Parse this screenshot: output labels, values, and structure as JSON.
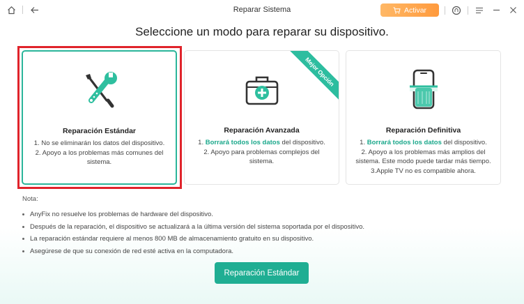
{
  "window": {
    "title": "Reparar Sistema",
    "activate_label": "Activar"
  },
  "heading": "Seleccione un modo para reparar su dispositivo.",
  "cards": [
    {
      "title": "Reparación Estándar",
      "line1": "1. No se eliminarán los datos del dispositivo.",
      "line2": "2. Apoyo a los problemas más comunes del sistema."
    },
    {
      "title": "Reparación Avanzada",
      "badge": "Mejor Opción",
      "line1_pre": "1. ",
      "line1_hl": "Borrará todos los datos",
      "line1_post": " del dispositivo.",
      "line2": "2. Apoyo para problemas complejos del sistema."
    },
    {
      "title": "Reparación Definitiva",
      "line1_pre": "1. ",
      "line1_hl": "Borrará todos los datos",
      "line1_post": " del dispositivo.",
      "line2": "2. Apoyo a los problemas más amplios del sistema. Este modo puede tardar más tiempo.",
      "line3": "3.Apple TV no es compatible ahora."
    }
  ],
  "note": {
    "title": "Nota:",
    "items": [
      "AnyFix no resuelve los problemas de hardware del dispositivo.",
      "Después de la reparación, el dispositivo se actualizará a la última versión del sistema soportada por el dispositivo.",
      "La reparación estándar requiere al menos 800 MB de almacenamiento gratuito en su dispositivo.",
      "Asegúrese de que su conexión de red esté activa en la computadora."
    ]
  },
  "action_button": "Reparación Estándar",
  "colors": {
    "accent": "#1fae93",
    "activate": "#ff9a3d",
    "highlight_frame": "#e0232b"
  }
}
